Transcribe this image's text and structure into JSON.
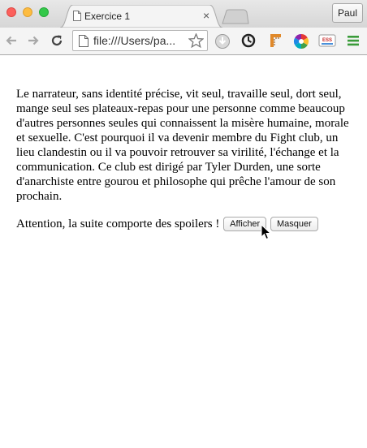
{
  "window": {
    "tab_title": "Exercice 1",
    "tab_close": "×",
    "profile_name": "Paul"
  },
  "toolbar": {
    "url": "file:///Users/paul/exercice1.html",
    "url_display": "file:///Users/pa...",
    "icons": [
      "back-arrow-icon",
      "forward-arrow-icon",
      "reload-icon",
      "document-icon",
      "bookmark-star-icon",
      "download-icon",
      "sync-icon",
      "ruler-icon",
      "color-wheel-icon",
      "ess-extension-icon",
      "menu-icon"
    ],
    "extension_label": "ESS"
  },
  "page": {
    "paragraph": "Le narrateur, sans identité précise, vit seul, travaille seul, dort seul, mange seul ses plateaux-repas pour une personne comme beaucoup d'autres personnes seules qui connaissent la misère humaine, morale et sexuelle. C'est pourquoi il va devenir membre du Fight club, un lieu clandestin ou il va pouvoir retrouver sa virilité, l'échange et la communication. Ce club est dirigé par Tyler Durden, une sorte d'anarchiste entre gourou et philosophe qui prêche l'amour de son prochain.",
    "spoiler_text": "Attention, la suite comporte des spoilers !",
    "show_button": "Afficher",
    "hide_button": "Masquer"
  },
  "colors": {
    "close": "#fc605c",
    "minimize": "#fdbc40",
    "maximize": "#34c84a",
    "menu_green": "#3a9b3a"
  }
}
